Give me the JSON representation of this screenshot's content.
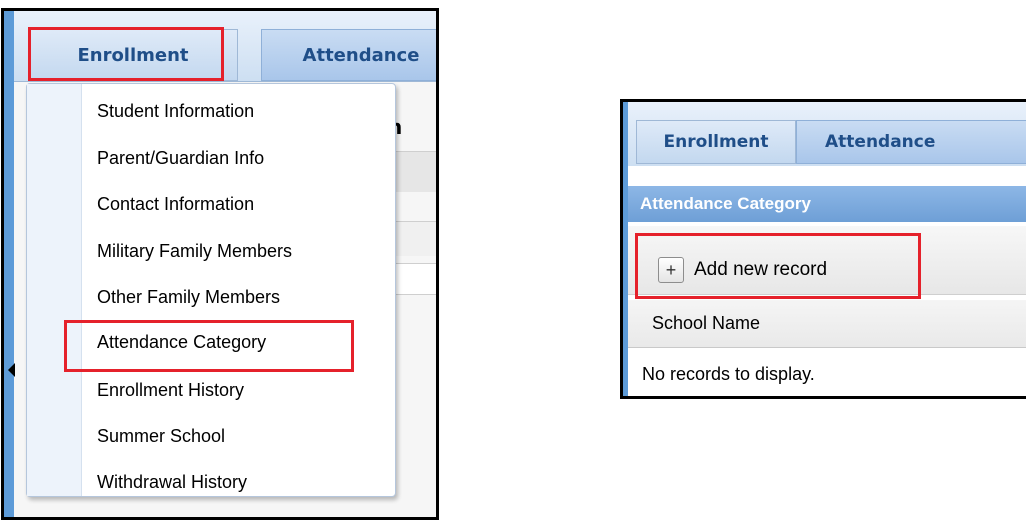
{
  "left_panel": {
    "tabs": [
      {
        "label": "Enrollment"
      },
      {
        "label": "Attendance"
      }
    ],
    "background_letter": "n",
    "menu": {
      "items": [
        {
          "label": "Student Information"
        },
        {
          "label": "Parent/Guardian Info"
        },
        {
          "label": "Contact Information"
        },
        {
          "label": "Military Family Members"
        },
        {
          "label": "Other Family Members"
        },
        {
          "label": "Attendance Category"
        },
        {
          "label": "Enrollment History"
        },
        {
          "label": "Summer School"
        },
        {
          "label": "Withdrawal History"
        }
      ],
      "highlighted_item": "Attendance Category"
    }
  },
  "right_panel": {
    "tabs": [
      {
        "label": "Enrollment"
      },
      {
        "label": "Attendance"
      }
    ],
    "section_title": "Attendance Category",
    "toolbar": {
      "add_icon": "+",
      "add_label": "Add new record"
    },
    "grid": {
      "columns": [
        "School Name"
      ],
      "empty_message": "No records to display."
    }
  },
  "colors": {
    "highlight_box": "#e5212b",
    "accent_blue": "#5d9bd8",
    "tab_text": "#1f4e88"
  }
}
